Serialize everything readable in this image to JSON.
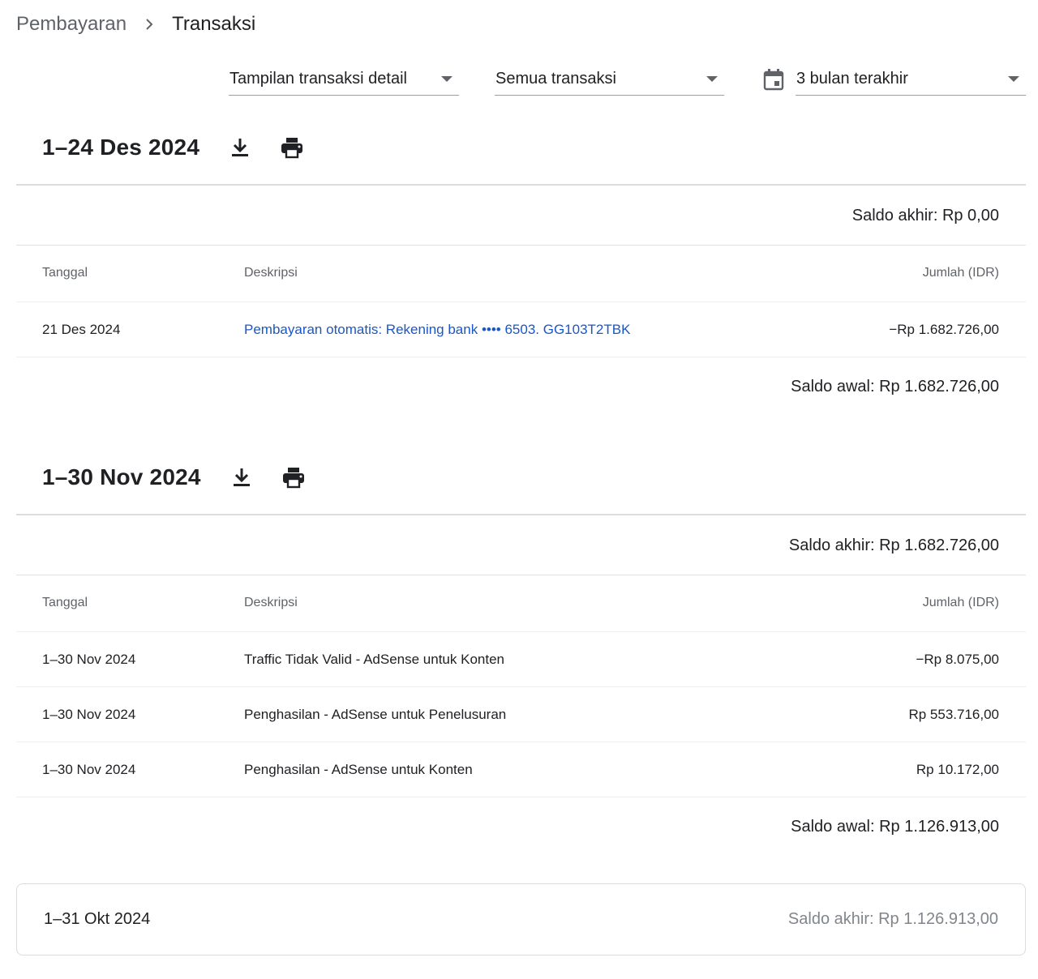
{
  "breadcrumb": {
    "root": "Pembayaran",
    "current": "Transaksi"
  },
  "filters": {
    "view": "Tampilan transaksi detail",
    "type": "Semua transaksi",
    "range": "3 bulan terakhir"
  },
  "sections": [
    {
      "title": "1–24 Des 2024",
      "saldo_akhir": "Saldo akhir: Rp 0,00",
      "headers": {
        "date": "Tanggal",
        "desc": "Deskripsi",
        "amount": "Jumlah (IDR)"
      },
      "rows": [
        {
          "date": "21 Des 2024",
          "desc": "Pembayaran otomatis: Rekening bank •••• 6503. GG103T2TBK",
          "amount": "−Rp 1.682.726,00"
        }
      ],
      "saldo_awal": "Saldo awal: Rp 1.682.726,00"
    },
    {
      "title": "1–30 Nov 2024",
      "saldo_akhir": "Saldo akhir: Rp 1.682.726,00",
      "headers": {
        "date": "Tanggal",
        "desc": "Deskripsi",
        "amount": "Jumlah (IDR)"
      },
      "rows": [
        {
          "date": "1–30 Nov 2024",
          "desc": "Traffic Tidak Valid - AdSense untuk Konten",
          "amount": "−Rp 8.075,00"
        },
        {
          "date": "1–30 Nov 2024",
          "desc": "Penghasilan - AdSense untuk Penelusuran",
          "amount": "Rp 553.716,00"
        },
        {
          "date": "1–30 Nov 2024",
          "desc": "Penghasilan - AdSense untuk Konten",
          "amount": "Rp 10.172,00"
        }
      ],
      "saldo_awal": "Saldo awal: Rp 1.126.913,00"
    }
  ],
  "collapsed": {
    "period": "1–31 Okt 2024",
    "saldo_akhir": "Saldo akhir: Rp 1.126.913,00"
  },
  "icons": {
    "download": "download-icon",
    "print": "print-icon",
    "calendar": "calendar-icon",
    "chevron": "chevron-right-icon",
    "dropdown": "dropdown-arrow-icon"
  },
  "colors": {
    "link": "#1a57c6",
    "muted": "#5f6368",
    "divider": "#dadce0"
  }
}
